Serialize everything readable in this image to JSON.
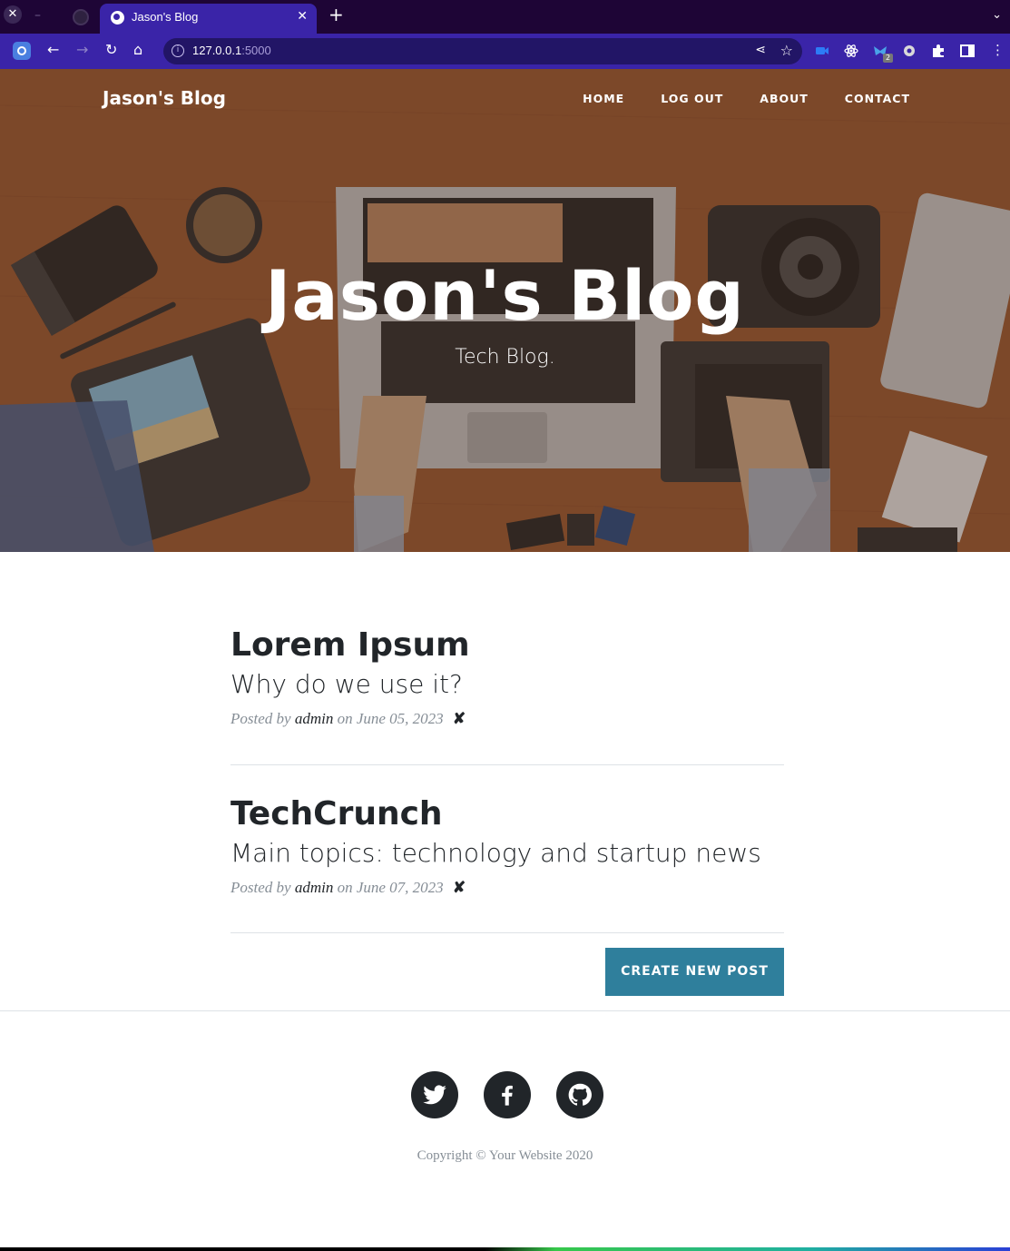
{
  "browser": {
    "tab_title": "Jason's Blog",
    "url_host": "127.0.0.1",
    "url_port": ":5000",
    "extension_badge": "2"
  },
  "site": {
    "brand": "Jason's Blog",
    "nav": [
      "HOME",
      "LOG OUT",
      "ABOUT",
      "CONTACT"
    ],
    "hero_title": "Jason's Blog",
    "hero_subtitle": "Tech Blog."
  },
  "posts": [
    {
      "title": "Lorem Ipsum",
      "subtitle": "Why do we use it?",
      "posted_by": "Posted by",
      "author": "admin",
      "on": "on June 05, 2023",
      "delete": "✘"
    },
    {
      "title": "TechCrunch",
      "subtitle": "Main topics: technology and startup news",
      "posted_by": "Posted by",
      "author": "admin",
      "on": "on June 07, 2023",
      "delete": "✘"
    }
  ],
  "create_button": "CREATE NEW POST",
  "footer": {
    "social": [
      "twitter-icon",
      "facebook-icon",
      "github-icon"
    ],
    "copyright": "Copyright © Your Website 2020"
  },
  "colors": {
    "browser_bg": "#1e0536",
    "browser_accent": "#3a24a8",
    "button": "#2f7f9c",
    "text_dark": "#212529",
    "text_muted": "#868e96"
  }
}
